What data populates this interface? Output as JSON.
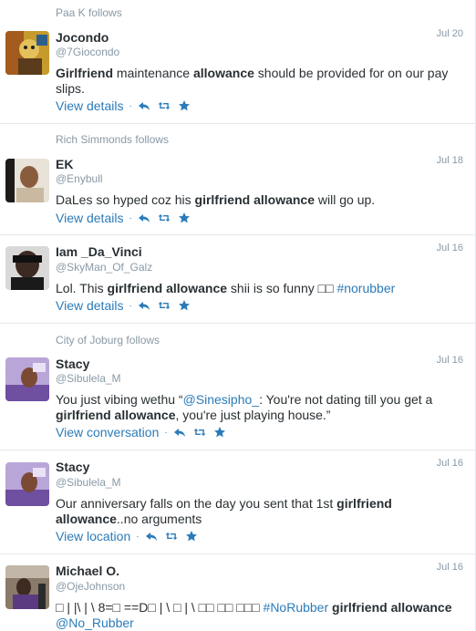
{
  "colors": {
    "link": "#2b7bb9",
    "meta": "#8899a6",
    "text": "#292f33"
  },
  "tweets": [
    {
      "context": "Paa K follows",
      "name": "Jocondo",
      "handle": "@7Giocondo",
      "time": "Jul 20",
      "segments": [
        {
          "t": "Girlfriend",
          "b": true
        },
        {
          "t": " maintenance "
        },
        {
          "t": "allowance",
          "b": true
        },
        {
          "t": " should be provided for on our pay slips."
        }
      ],
      "action_label": "View details",
      "avatar_icon": "painting-avatar"
    },
    {
      "context": "Rich Simmonds follows",
      "name": "EK",
      "handle": "@Enybull",
      "time": "Jul 18",
      "segments": [
        {
          "t": "DaLes so hyped coz his "
        },
        {
          "t": "girlfriend allowance",
          "b": true
        },
        {
          "t": " will go up."
        }
      ],
      "action_label": "View details",
      "avatar_icon": "photo-avatar"
    },
    {
      "context": "",
      "name": "Iam _Da_Vinci",
      "handle": "@SkyMan_Of_Galz",
      "time": "Jul 16",
      "segments": [
        {
          "t": "Lol. This "
        },
        {
          "t": "girlfriend allowance",
          "b": true
        },
        {
          "t": " shii is so funny □□ "
        },
        {
          "t": "#norubber",
          "link": true
        }
      ],
      "action_label": "View details",
      "avatar_icon": "photo-avatar"
    },
    {
      "context": "City of Joburg follows",
      "name": "Stacy",
      "handle": "@Sibulela_M",
      "time": "Jul 16",
      "segments": [
        {
          "t": "You just vibing wethu “"
        },
        {
          "t": "@Sinesipho_",
          "link": true
        },
        {
          "t": ": You're not dating till you get a "
        },
        {
          "t": "girlfriend allowance",
          "b": true
        },
        {
          "t": ", you're just playing house.”"
        }
      ],
      "action_label": "View conversation",
      "avatar_icon": "photo-avatar"
    },
    {
      "context": "",
      "name": "Stacy",
      "handle": "@Sibulela_M",
      "time": "Jul 16",
      "segments": [
        {
          "t": "Our anniversary falls on the day you sent that 1st "
        },
        {
          "t": "girlfriend allowance",
          "b": true
        },
        {
          "t": "..no arguments"
        }
      ],
      "action_label": "View location",
      "avatar_icon": "photo-avatar"
    },
    {
      "context": "",
      "name": "Michael O.",
      "handle": "@OjeJohnson",
      "time": "Jul 16",
      "segments": [
        {
          "t": "□ | |\\ | \\ 8=□ ==D□ | \\ □ | \\ □□ □□ □□□ "
        },
        {
          "t": "#NoRubber",
          "link": true
        },
        {
          "t": " "
        },
        {
          "t": "girlfriend allowance",
          "b": true
        },
        {
          "t": " "
        },
        {
          "t": "@No_Rubber",
          "link": true
        }
      ],
      "action_label": "",
      "avatar_icon": "photo-avatar"
    }
  ]
}
